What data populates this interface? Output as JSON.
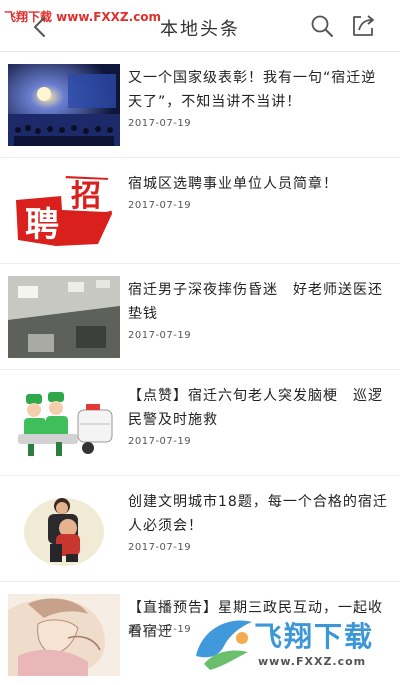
{
  "watermark": {
    "top_left": "飞翔下载 www.FXXZ.com",
    "bottom_right_name": "飞翔下载",
    "bottom_right_url": "www.FXXZ.com"
  },
  "header": {
    "title": "本地头条",
    "back_icon": "chevron-left-icon",
    "search_icon": "search-icon",
    "share_icon": "share-icon"
  },
  "colors": {
    "watermark_red": "#e0302c",
    "watermark_blue": "#2c8fd6",
    "recruit_red": "#d9201c"
  },
  "recruit_thumb_text": [
    "招",
    "聘"
  ],
  "articles": [
    {
      "title": "又一个国家级表彰！我有一句“宿迁逆天了”，不知当讲不当讲！",
      "date": "2017-07-19",
      "thumb": "conference-stage"
    },
    {
      "title": "宿城区选聘事业单位人员简章！",
      "date": "2017-07-19",
      "thumb": "recruitment-seal"
    },
    {
      "title": "宿迁男子深夜摔伤昏迷　好老师送医还垫钱",
      "date": "2017-07-19",
      "thumb": "hospital-corridor"
    },
    {
      "title": "【点赞】宿迁六旬老人突发脑梗　巡逻民警及时施救",
      "date": "2017-07-19",
      "thumb": "cartoon-medics"
    },
    {
      "title": "创建文明城市18题，每一个合格的宿迁人必须会！",
      "date": "2017-07-19",
      "thumb": "person-with-child"
    },
    {
      "title": "【直播预告】星期三政民互动，一起收看宿迁",
      "date": "2017-07-19",
      "thumb": "cartoon-girls-hug"
    }
  ]
}
